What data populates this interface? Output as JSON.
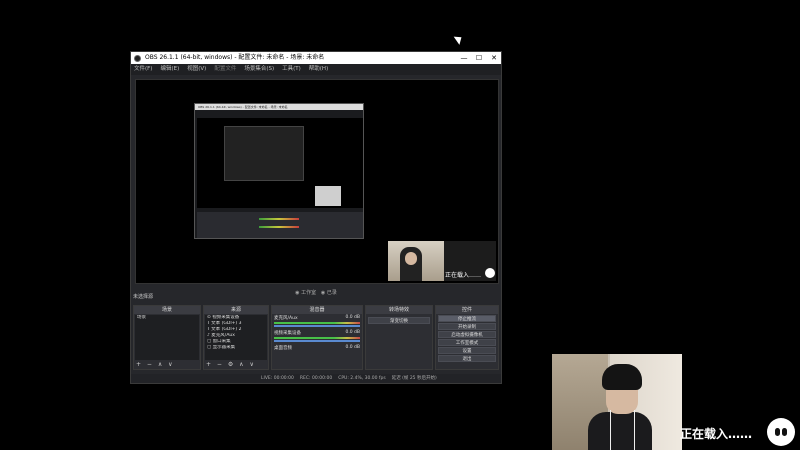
{
  "window": {
    "title": "OBS 26.1.1 (64-bit, windows) - 配置文件: 未命名 - 场景: 未命名",
    "controls": [
      "—",
      "☐",
      "✕"
    ]
  },
  "menu": [
    "文件(F)",
    "编辑(E)",
    "视图(V)",
    "配置文件",
    "场景集合(S)",
    "工具(T)",
    "帮助(H)"
  ],
  "preview": {
    "pip_loading_text": "正在载入……"
  },
  "mode": {
    "studio": "◉ 工作室",
    "recording": "◉ 已录"
  },
  "no_scene": "未选择源",
  "docks": {
    "scenes": {
      "title": "场景",
      "items": [
        "场景"
      ],
      "footer": "+ − ∧ ∨"
    },
    "sources": {
      "title": "来源",
      "items": [
        "⊙ 视频采集设备",
        "T 文本 (GDI+) 3",
        "T 文本 (GDI+) 2",
        "♪ 麦克风/Aux",
        "▢ 窗口采集",
        "▢ 显示器采集"
      ],
      "footer": "+ − ⚙ ∧ ∨"
    },
    "mixer": {
      "title": "混音器",
      "channels": [
        {
          "name": "麦克风/Aux",
          "db": "0.0 dB"
        },
        {
          "name": "视频采集设备",
          "db": "0.0 dB"
        },
        {
          "name": "桌面音频",
          "db": "0.0 dB"
        }
      ]
    },
    "transitions": {
      "title": "转场特效",
      "selected": "渐变切换"
    },
    "controls": {
      "title": "控件",
      "buttons": [
        "停止推流",
        "开始录制",
        "启动虚拟摄像机",
        "工作室模式",
        "设置",
        "退出"
      ]
    }
  },
  "statusbar": [
    "LIVE: 00:00:00",
    "REC: 00:00:00",
    "CPU: 2.4%, 30.00 fps",
    "延迟 (帧 25 秒后开始)"
  ],
  "overlay": {
    "loading_text": "正在载入……"
  }
}
